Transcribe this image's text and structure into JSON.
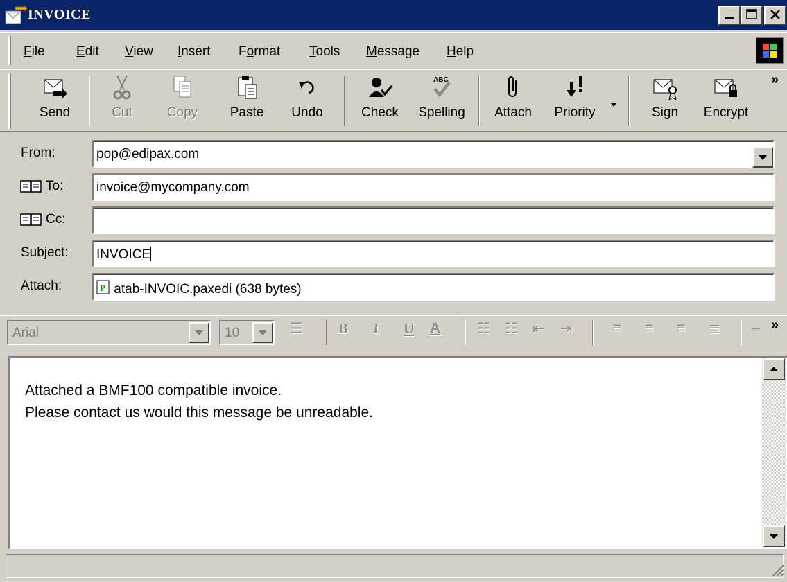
{
  "window": {
    "title": "INVOICE",
    "controls": [
      "minimize-icon",
      "maximize-icon",
      "close-icon"
    ]
  },
  "menu": {
    "items": [
      {
        "label": "File",
        "mnemonic": "F"
      },
      {
        "label": "Edit",
        "mnemonic": "E"
      },
      {
        "label": "View",
        "mnemonic": "V"
      },
      {
        "label": "Insert",
        "mnemonic": "I"
      },
      {
        "label": "Format",
        "mnemonic": "o"
      },
      {
        "label": "Tools",
        "mnemonic": "T"
      },
      {
        "label": "Message",
        "mnemonic": "M"
      },
      {
        "label": "Help",
        "mnemonic": "H"
      }
    ]
  },
  "toolbar": {
    "buttons": [
      {
        "label": "Send",
        "icon": "send-icon",
        "enabled": true
      },
      {
        "label": "Cut",
        "icon": "scissors-icon",
        "enabled": false
      },
      {
        "label": "Copy",
        "icon": "copy-icon",
        "enabled": false
      },
      {
        "label": "Paste",
        "icon": "paste-icon",
        "enabled": true
      },
      {
        "label": "Undo",
        "icon": "undo-icon",
        "enabled": true
      },
      {
        "label": "Check",
        "icon": "check-names-icon",
        "enabled": true
      },
      {
        "label": "Spelling",
        "icon": "spelling-icon",
        "enabled": true
      },
      {
        "label": "Attach",
        "icon": "paperclip-icon",
        "enabled": true
      },
      {
        "label": "Priority",
        "icon": "priority-icon",
        "enabled": true
      },
      {
        "label": "Sign",
        "icon": "sign-icon",
        "enabled": true
      },
      {
        "label": "Encrypt",
        "icon": "encrypt-icon",
        "enabled": true
      }
    ],
    "overflow": "»"
  },
  "header": {
    "from_label": "From:",
    "from_value": "pop@edipax.com",
    "to_label": "To:",
    "to_value": "invoice@mycompany.com",
    "cc_label": "Cc:",
    "cc_value": "",
    "subject_label": "Subject:",
    "subject_value": "INVOICE",
    "attach_label": "Attach:",
    "attachment": "atab-INVOIC.paxedi (638 bytes)"
  },
  "format_bar": {
    "font": "Arial",
    "size": "10",
    "bold": "B",
    "italic": "I",
    "underline": "U",
    "font_color": "A",
    "overflow": "»"
  },
  "message": {
    "lines": [
      "Attached a BMF100 compatible invoice.",
      "Please contact us would this message be unreadable."
    ]
  },
  "status": {
    "text": ""
  },
  "colors": {
    "titlebar": "#0a246a",
    "chrome": "#d4d0c8",
    "disabled_text": "#808080"
  }
}
